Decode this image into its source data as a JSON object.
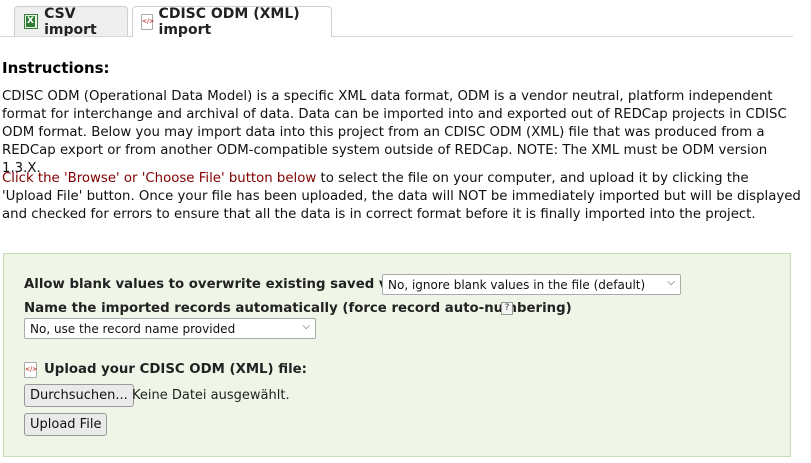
{
  "tabs": [
    {
      "label": "CSV import",
      "icon": "excel-icon"
    },
    {
      "label": "CDISC ODM (XML) import",
      "icon": "xml-file-icon"
    }
  ],
  "instructions": {
    "title": "Instructions:",
    "paragraph1": "CDISC ODM (Operational Data Model) is a specific XML data format, ODM is a vendor neutral, platform independent format for interchange and archival of data. Data can be imported into and exported out of REDCap projects in CDISC ODM format. Below you may import data into this project from an CDISC ODM (XML) file that was produced from a REDCap export or from another ODM-compatible system outside of REDCap. NOTE: The XML must be ODM version 1.3.X.",
    "paragraph2_highlight": "Click the 'Browse' or 'Choose File' button below",
    "paragraph2_rest": " to select the file on your computer, and upload it by clicking the 'Upload File' button. Once your file has been uploaded, the data will NOT be immediately imported but will be displayed and checked for errors to ensure that all the data is in correct format before it is finally imported into the project."
  },
  "form": {
    "blank_label": "Allow blank values to overwrite existing saved values?",
    "blank_value": "No, ignore blank values in the file (default)",
    "autonumber_label": "Name the imported records automatically (force record auto-numbering)",
    "help_glyph": "?",
    "autonumber_value": "No, use the record name provided",
    "upload_label": "Upload your CDISC ODM (XML) file:",
    "browse_label": "Durchsuchen...",
    "no_file_text": "Keine Datei ausgewählt.",
    "upload_button": "Upload File"
  },
  "colors": {
    "form_bg": "#eff6e8",
    "highlight_text": "#800000"
  }
}
